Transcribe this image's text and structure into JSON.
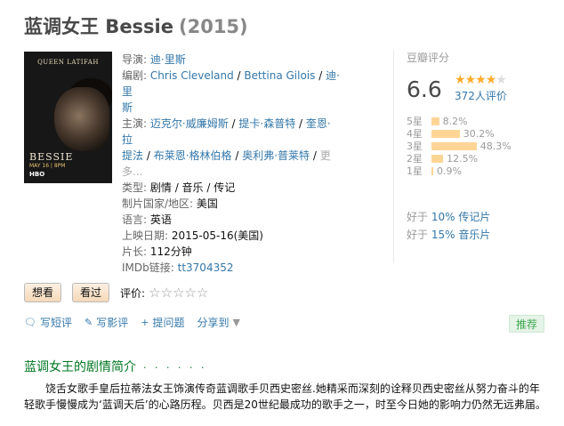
{
  "header": {
    "title": "蓝调女王 Bessie",
    "year": "(2015)"
  },
  "poster": {
    "top_text": "QUEEN LATIFAH",
    "name_text": "BESSIE",
    "date_text": "MAY 16 | 8PM",
    "network_text": "HBO"
  },
  "info": {
    "director_label": "导演:",
    "director": "迪·里斯",
    "writer_label": "编剧:",
    "writers": [
      "Chris Cleveland",
      "Bettina Gilois",
      "迪·里"
    ],
    "writer_cont": "斯",
    "cast_label": "主演:",
    "cast_line1": [
      "迈克尔·威廉姆斯",
      "提卡·森普特",
      "奎恩·拉"
    ],
    "cast_line2": [
      "提法",
      "布莱恩·格林伯格",
      "奥利弗·普莱特"
    ],
    "cast_more": "更多...",
    "genre_label": "类型:",
    "genre": "剧情 / 音乐 / 传记",
    "country_label": "制片国家/地区:",
    "country": "美国",
    "lang_label": "语言:",
    "lang": "英语",
    "release_label": "上映日期:",
    "release": "2015-05-16(美国)",
    "runtime_label": "片长:",
    "runtime": "112分钟",
    "imdb_label": "IMDb链接:",
    "imdb": "tt3704352"
  },
  "rating": {
    "header": "豆瓣评分",
    "score": "6.6",
    "stars_value": 3.5,
    "votes": "372人评价",
    "bars": [
      {
        "label": "5星",
        "pct": "8.2%",
        "value": 8.2
      },
      {
        "label": "4星",
        "pct": "30.2%",
        "value": 30.2
      },
      {
        "label": "3星",
        "pct": "48.3%",
        "value": 48.3
      },
      {
        "label": "2星",
        "pct": "12.5%",
        "value": 12.5
      },
      {
        "label": "1星",
        "pct": "0.9%",
        "value": 0.9
      }
    ],
    "better1_prefix": "好于",
    "better1_link": "10% 传记片",
    "better2_prefix": "好于",
    "better2_link": "15% 音乐片"
  },
  "actions": {
    "want": "想看",
    "seen": "看过",
    "rate_label": "评价:",
    "empty_stars": "☆☆☆☆☆"
  },
  "links": {
    "short_review": "写短评",
    "review": "写影评",
    "question": "提问题",
    "share": "分享到",
    "recommend": "推荐"
  },
  "synopsis": {
    "title": "蓝调女王的剧情简介",
    "dots": "· · · · · ·",
    "text": "饶舌女歌手皇后拉蒂法女王饰演传奇蓝调歌手贝西史密丝.她精采而深刻的诠释贝西史密丝从努力奋斗的年轻歌手慢慢成为‘蓝调天后’的心路历程。贝西是20世纪最成功的歌手之一，时至今日她的影响力仍然无远弗届。"
  },
  "colors": {
    "link": "#3377aa",
    "star": "#ffac2d",
    "bar": "#ffd596",
    "green": "#007722"
  }
}
